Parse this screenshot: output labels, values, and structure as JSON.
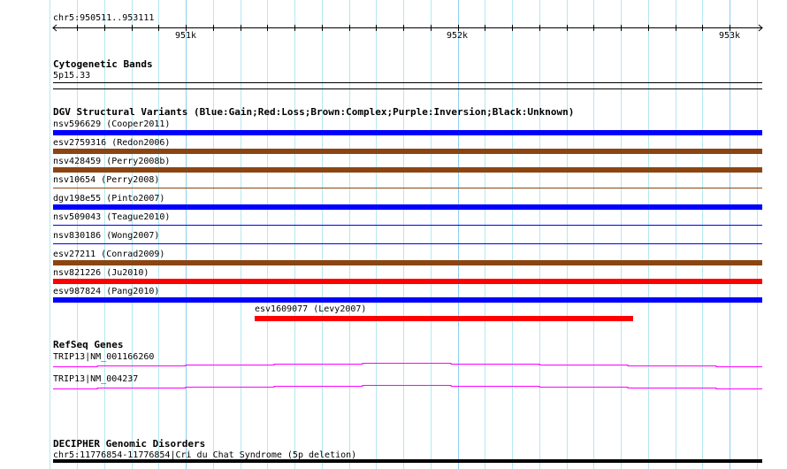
{
  "ruler": {
    "location": "chr5:950511..953111",
    "ticks": [
      {
        "label": "951k",
        "pos": 951000
      },
      {
        "label": "952k",
        "pos": 952000
      },
      {
        "label": "953k",
        "pos": 953000
      }
    ],
    "start": 950511,
    "end": 953111
  },
  "cytobands": {
    "title": "Cytogenetic Bands",
    "band": "5p15.33"
  },
  "dgv": {
    "title": "DGV Structural Variants (Blue:Gain;Red:Loss;Brown:Complex;Purple:Inversion;Black:Unknown)",
    "colors": {
      "gain": "#0000ff",
      "loss": "#ff0000",
      "complex": "#8b4513"
    },
    "variants": [
      {
        "label": "nsv596629 (Cooper2011)",
        "type": "gain",
        "thick": true
      },
      {
        "label": "esv2759316 (Redon2006)",
        "type": "complex",
        "thick": true
      },
      {
        "label": "nsv428459 (Perry2008b)",
        "type": "complex",
        "thick": true
      },
      {
        "label": "nsv10654 (Perry2008)",
        "type": "complex",
        "thick": false
      },
      {
        "label": "dgv198e55 (Pinto2007)",
        "type": "gain",
        "thick": true
      },
      {
        "label": "nsv509043 (Teague2010)",
        "type": "gain",
        "thick": false
      },
      {
        "label": "nsv830186 (Wong2007)",
        "type": "gain",
        "thick": false
      },
      {
        "label": "esv27211 (Conrad2009)",
        "type": "complex",
        "thick": true
      },
      {
        "label": "nsv821226 (Ju2010)",
        "type": "loss",
        "thick": true
      },
      {
        "label": "esv987824 (Pang2010)",
        "type": "gain",
        "thick": true
      }
    ],
    "partial": {
      "label": "esv1609077 (Levy2007)",
      "type": "loss"
    }
  },
  "refseq": {
    "title": "RefSeq Genes",
    "color": "#ff00ff",
    "genes": [
      {
        "label": "TRIP13|NM_001166260"
      },
      {
        "label": "TRIP13|NM_004237"
      }
    ]
  },
  "decipher": {
    "title": "DECIPHER Genomic Disorders",
    "entry": "chr5:11776854-11776854|Cri du Chat Syndrome (5p deletion)"
  }
}
